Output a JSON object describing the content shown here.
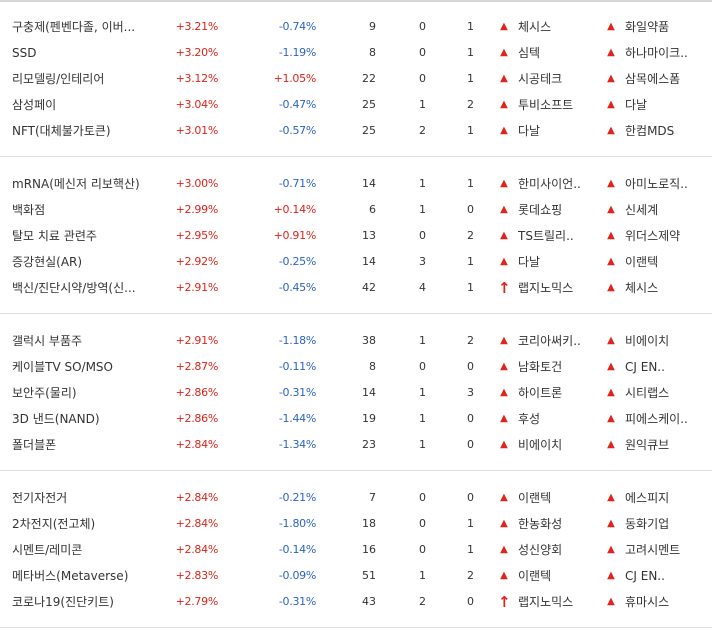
{
  "colors": {
    "up": "#e2231a",
    "down": "#2b63c7",
    "text": "#333333",
    "divider": "#dddddd"
  },
  "groups": [
    {
      "rows": [
        {
          "theme": "구충제(펜벤다졸, 이버...",
          "rate": "+3.21%",
          "change": "-0.74%",
          "dir": "down",
          "n1": "9",
          "n2": "0",
          "n3": "1",
          "stock1": {
            "icon": "▲",
            "name": "체시스"
          },
          "stock2": {
            "icon": "▲",
            "name": "화일약품"
          }
        },
        {
          "theme": "SSD",
          "rate": "+3.20%",
          "change": "-1.19%",
          "dir": "down",
          "n1": "8",
          "n2": "0",
          "n3": "1",
          "stock1": {
            "icon": "▲",
            "name": "심텍"
          },
          "stock2": {
            "icon": "▲",
            "name": "하나마이크.."
          }
        },
        {
          "theme": "리모델링/인테리어",
          "rate": "+3.12%",
          "change": "+1.05%",
          "dir": "up",
          "n1": "22",
          "n2": "0",
          "n3": "1",
          "stock1": {
            "icon": "▲",
            "name": "시공테크"
          },
          "stock2": {
            "icon": "▲",
            "name": "삼목에스폼"
          }
        },
        {
          "theme": "삼성페이",
          "rate": "+3.04%",
          "change": "-0.47%",
          "dir": "down",
          "n1": "25",
          "n2": "1",
          "n3": "2",
          "stock1": {
            "icon": "▲",
            "name": "투비소프트"
          },
          "stock2": {
            "icon": "▲",
            "name": "다날"
          }
        },
        {
          "theme": "NFT(대체불가토큰)",
          "rate": "+3.01%",
          "change": "-0.57%",
          "dir": "down",
          "n1": "25",
          "n2": "2",
          "n3": "1",
          "stock1": {
            "icon": "▲",
            "name": "다날"
          },
          "stock2": {
            "icon": "▲",
            "name": "한컴MDS"
          }
        }
      ]
    },
    {
      "rows": [
        {
          "theme": "mRNA(메신저 리보핵산)",
          "rate": "+3.00%",
          "change": "-0.71%",
          "dir": "down",
          "n1": "14",
          "n2": "1",
          "n3": "1",
          "stock1": {
            "icon": "▲",
            "name": "한미사이언.."
          },
          "stock2": {
            "icon": "▲",
            "name": "아미노로직.."
          }
        },
        {
          "theme": "백화점",
          "rate": "+2.99%",
          "change": "+0.14%",
          "dir": "up",
          "n1": "6",
          "n2": "1",
          "n3": "0",
          "stock1": {
            "icon": "▲",
            "name": "롯데쇼핑"
          },
          "stock2": {
            "icon": "▲",
            "name": "신세계"
          }
        },
        {
          "theme": "탈모 치료 관련주",
          "rate": "+2.95%",
          "change": "+0.91%",
          "dir": "up",
          "n1": "13",
          "n2": "0",
          "n3": "2",
          "stock1": {
            "icon": "▲",
            "name": "TS트릴리.."
          },
          "stock2": {
            "icon": "▲",
            "name": "위더스제약"
          }
        },
        {
          "theme": "증강현실(AR)",
          "rate": "+2.92%",
          "change": "-0.25%",
          "dir": "down",
          "n1": "14",
          "n2": "3",
          "n3": "1",
          "stock1": {
            "icon": "▲",
            "name": "다날"
          },
          "stock2": {
            "icon": "▲",
            "name": "이랜텍"
          }
        },
        {
          "theme": "백신/진단시약/방역(신...",
          "rate": "+2.91%",
          "change": "-0.45%",
          "dir": "down",
          "n1": "42",
          "n2": "4",
          "n3": "1",
          "stock1": {
            "icon": "↑",
            "name": "랩지노믹스"
          },
          "stock2": {
            "icon": "▲",
            "name": "체시스"
          }
        }
      ]
    },
    {
      "rows": [
        {
          "theme": "갤럭시 부품주",
          "rate": "+2.91%",
          "change": "-1.18%",
          "dir": "down",
          "n1": "38",
          "n2": "1",
          "n3": "2",
          "stock1": {
            "icon": "▲",
            "name": "코리아써키.."
          },
          "stock2": {
            "icon": "▲",
            "name": "비에이치"
          }
        },
        {
          "theme": "케이블TV SO/MSO",
          "rate": "+2.87%",
          "change": "-0.11%",
          "dir": "down",
          "n1": "8",
          "n2": "0",
          "n3": "0",
          "stock1": {
            "icon": "▲",
            "name": "남화토건"
          },
          "stock2": {
            "icon": "▲",
            "name": "CJ EN.."
          }
        },
        {
          "theme": "보안주(물리)",
          "rate": "+2.86%",
          "change": "-0.31%",
          "dir": "down",
          "n1": "14",
          "n2": "1",
          "n3": "3",
          "stock1": {
            "icon": "▲",
            "name": "하이트론"
          },
          "stock2": {
            "icon": "▲",
            "name": "시티랩스"
          }
        },
        {
          "theme": "3D 낸드(NAND)",
          "rate": "+2.86%",
          "change": "-1.44%",
          "dir": "down",
          "n1": "19",
          "n2": "1",
          "n3": "0",
          "stock1": {
            "icon": "▲",
            "name": "후성"
          },
          "stock2": {
            "icon": "▲",
            "name": "피에스케이.."
          }
        },
        {
          "theme": "폴더블폰",
          "rate": "+2.84%",
          "change": "-1.34%",
          "dir": "down",
          "n1": "23",
          "n2": "1",
          "n3": "0",
          "stock1": {
            "icon": "▲",
            "name": "비에이치"
          },
          "stock2": {
            "icon": "▲",
            "name": "원익큐브"
          }
        }
      ]
    },
    {
      "rows": [
        {
          "theme": "전기자전거",
          "rate": "+2.84%",
          "change": "-0.21%",
          "dir": "down",
          "n1": "7",
          "n2": "0",
          "n3": "0",
          "stock1": {
            "icon": "▲",
            "name": "이랜텍"
          },
          "stock2": {
            "icon": "▲",
            "name": "에스피지"
          }
        },
        {
          "theme": "2차전지(전고체)",
          "rate": "+2.84%",
          "change": "-1.80%",
          "dir": "down",
          "n1": "18",
          "n2": "0",
          "n3": "1",
          "stock1": {
            "icon": "▲",
            "name": "한농화성"
          },
          "stock2": {
            "icon": "▲",
            "name": "동화기업"
          }
        },
        {
          "theme": "시멘트/레미콘",
          "rate": "+2.84%",
          "change": "-0.14%",
          "dir": "down",
          "n1": "16",
          "n2": "0",
          "n3": "1",
          "stock1": {
            "icon": "▲",
            "name": "성신양회"
          },
          "stock2": {
            "icon": "▲",
            "name": "고려시멘트"
          }
        },
        {
          "theme": "메타버스(Metaverse)",
          "rate": "+2.83%",
          "change": "-0.09%",
          "dir": "down",
          "n1": "51",
          "n2": "1",
          "n3": "2",
          "stock1": {
            "icon": "▲",
            "name": "이랜텍"
          },
          "stock2": {
            "icon": "▲",
            "name": "CJ EN.."
          }
        },
        {
          "theme": "코로나19(진단키트)",
          "rate": "+2.79%",
          "change": "-0.31%",
          "dir": "down",
          "n1": "43",
          "n2": "2",
          "n3": "0",
          "stock1": {
            "icon": "↑",
            "name": "랩지노믹스"
          },
          "stock2": {
            "icon": "▲",
            "name": "휴마시스"
          }
        }
      ]
    }
  ]
}
